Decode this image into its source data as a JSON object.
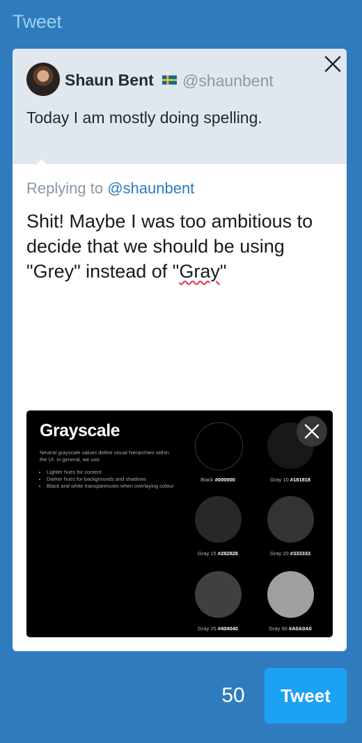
{
  "header": {
    "title": "Tweet"
  },
  "quoted_tweet": {
    "display_name": "Shaun Bent",
    "flag_icon": "sweden-flag-icon",
    "handle": "@shaunbent",
    "text": "Today I am mostly doing spelling."
  },
  "reply": {
    "replying_prefix": "Replying to",
    "replying_handle": "@shaunbent",
    "text_before": "Shit! Maybe I was too ambitious to decide that we should be using \"Grey\" instead of \"",
    "misspelled_word": "Gray",
    "text_after": "\""
  },
  "attachment": {
    "title": "Grayscale",
    "description": "Neutral grayscale values define visual hierarchies within the UI. In general, we use:",
    "list": [
      "Lighter hues for content",
      "Darker hues for backgrounds and shadows",
      "Black and white transparencies when overlaying colour"
    ],
    "swatches": [
      {
        "name": "Black",
        "hex": "#000000",
        "color": "#000000"
      },
      {
        "name": "Gray 10",
        "hex": "#181818",
        "color": "#181818"
      },
      {
        "name": "Gray 15",
        "hex": "#282828",
        "color": "#282828"
      },
      {
        "name": "Gray 20",
        "hex": "#333333",
        "color": "#333333"
      },
      {
        "name": "Gray 25",
        "hex": "#404040",
        "color": "#404040"
      },
      {
        "name": "Gray 60",
        "hex": "#A0A0A0",
        "color": "#A0A0A0"
      }
    ]
  },
  "footer": {
    "char_count": "50",
    "tweet_label": "Tweet"
  },
  "colors": {
    "background": "#2f7bbd",
    "accent": "#1da1f2",
    "mention": "#2b7bbf",
    "spellcheck": "#e0314d"
  }
}
